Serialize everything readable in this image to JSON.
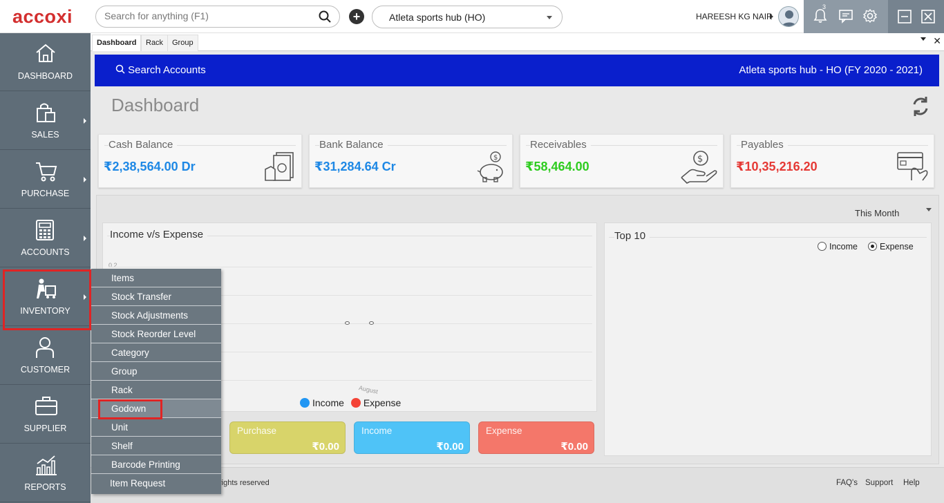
{
  "app": {
    "logo_text": "accoxi"
  },
  "topbar": {
    "search_placeholder": "Search for anything (F1)",
    "company": "Atleta sports hub (HO)",
    "user_name": "HAREESH  KG NAIR",
    "notification_count": "3"
  },
  "sidebar": {
    "items": [
      {
        "label": "DASHBOARD",
        "icon": "home-icon"
      },
      {
        "label": "SALES",
        "icon": "shopping-bag-icon"
      },
      {
        "label": "PURCHASE",
        "icon": "cart-icon"
      },
      {
        "label": "ACCOUNTS",
        "icon": "calculator-icon"
      },
      {
        "label": "INVENTORY",
        "icon": "inventory-icon"
      },
      {
        "label": "CUSTOMER",
        "icon": "customer-icon"
      },
      {
        "label": "SUPPLIER",
        "icon": "briefcase-icon"
      },
      {
        "label": "REPORTS",
        "icon": "report-chart-icon"
      }
    ]
  },
  "tabs": [
    {
      "label": "Dashboard"
    },
    {
      "label": "Rack"
    },
    {
      "label": "Group"
    }
  ],
  "header": {
    "search_accounts": "Search Accounts",
    "company_title": "Atleta sports hub - HO (FY 2020 - 2021)",
    "page_title": "Dashboard"
  },
  "cards": [
    {
      "title": "Cash Balance",
      "value": "₹2,38,564.00 Dr",
      "color": "#1e88e5"
    },
    {
      "title": "Bank Balance",
      "value": "₹31,284.64 Cr",
      "color": "#1e88e5"
    },
    {
      "title": "Receivables",
      "value": "₹58,464.00",
      "color": "#2ecc1f"
    },
    {
      "title": "Payables",
      "value": "₹10,35,216.20",
      "color": "#e53935"
    }
  ],
  "period": "This Month",
  "income_expense": {
    "title": "Income v/s Expense",
    "y_tick": "0.2",
    "x_tick": "August",
    "legend": [
      {
        "label": "Income",
        "color": "#2196f3"
      },
      {
        "label": "Expense",
        "color": "#f44336"
      }
    ]
  },
  "top10": {
    "title": "Top 10",
    "options": [
      {
        "label": "Income",
        "selected": false
      },
      {
        "label": "Expense",
        "selected": true
      }
    ]
  },
  "mini_cards": [
    {
      "title": "Purchase",
      "value": "₹0.00",
      "color": "#d8d46a"
    },
    {
      "title": "Income",
      "value": "₹0.00",
      "color": "#4fc3f7"
    },
    {
      "title": "Expense",
      "value": "₹0.00",
      "color": "#f4776a"
    }
  ],
  "footer": {
    "copyright": "rights reserved",
    "links": [
      "FAQ's",
      "Support",
      "Help"
    ]
  },
  "inventory_menu": {
    "items": [
      "Items",
      "Stock Transfer",
      "Stock Adjustments",
      "Stock Reorder Level",
      "Category",
      "Group",
      "Rack",
      "Godown",
      "Unit",
      "Shelf",
      "Barcode Printing",
      "Item Request"
    ]
  }
}
